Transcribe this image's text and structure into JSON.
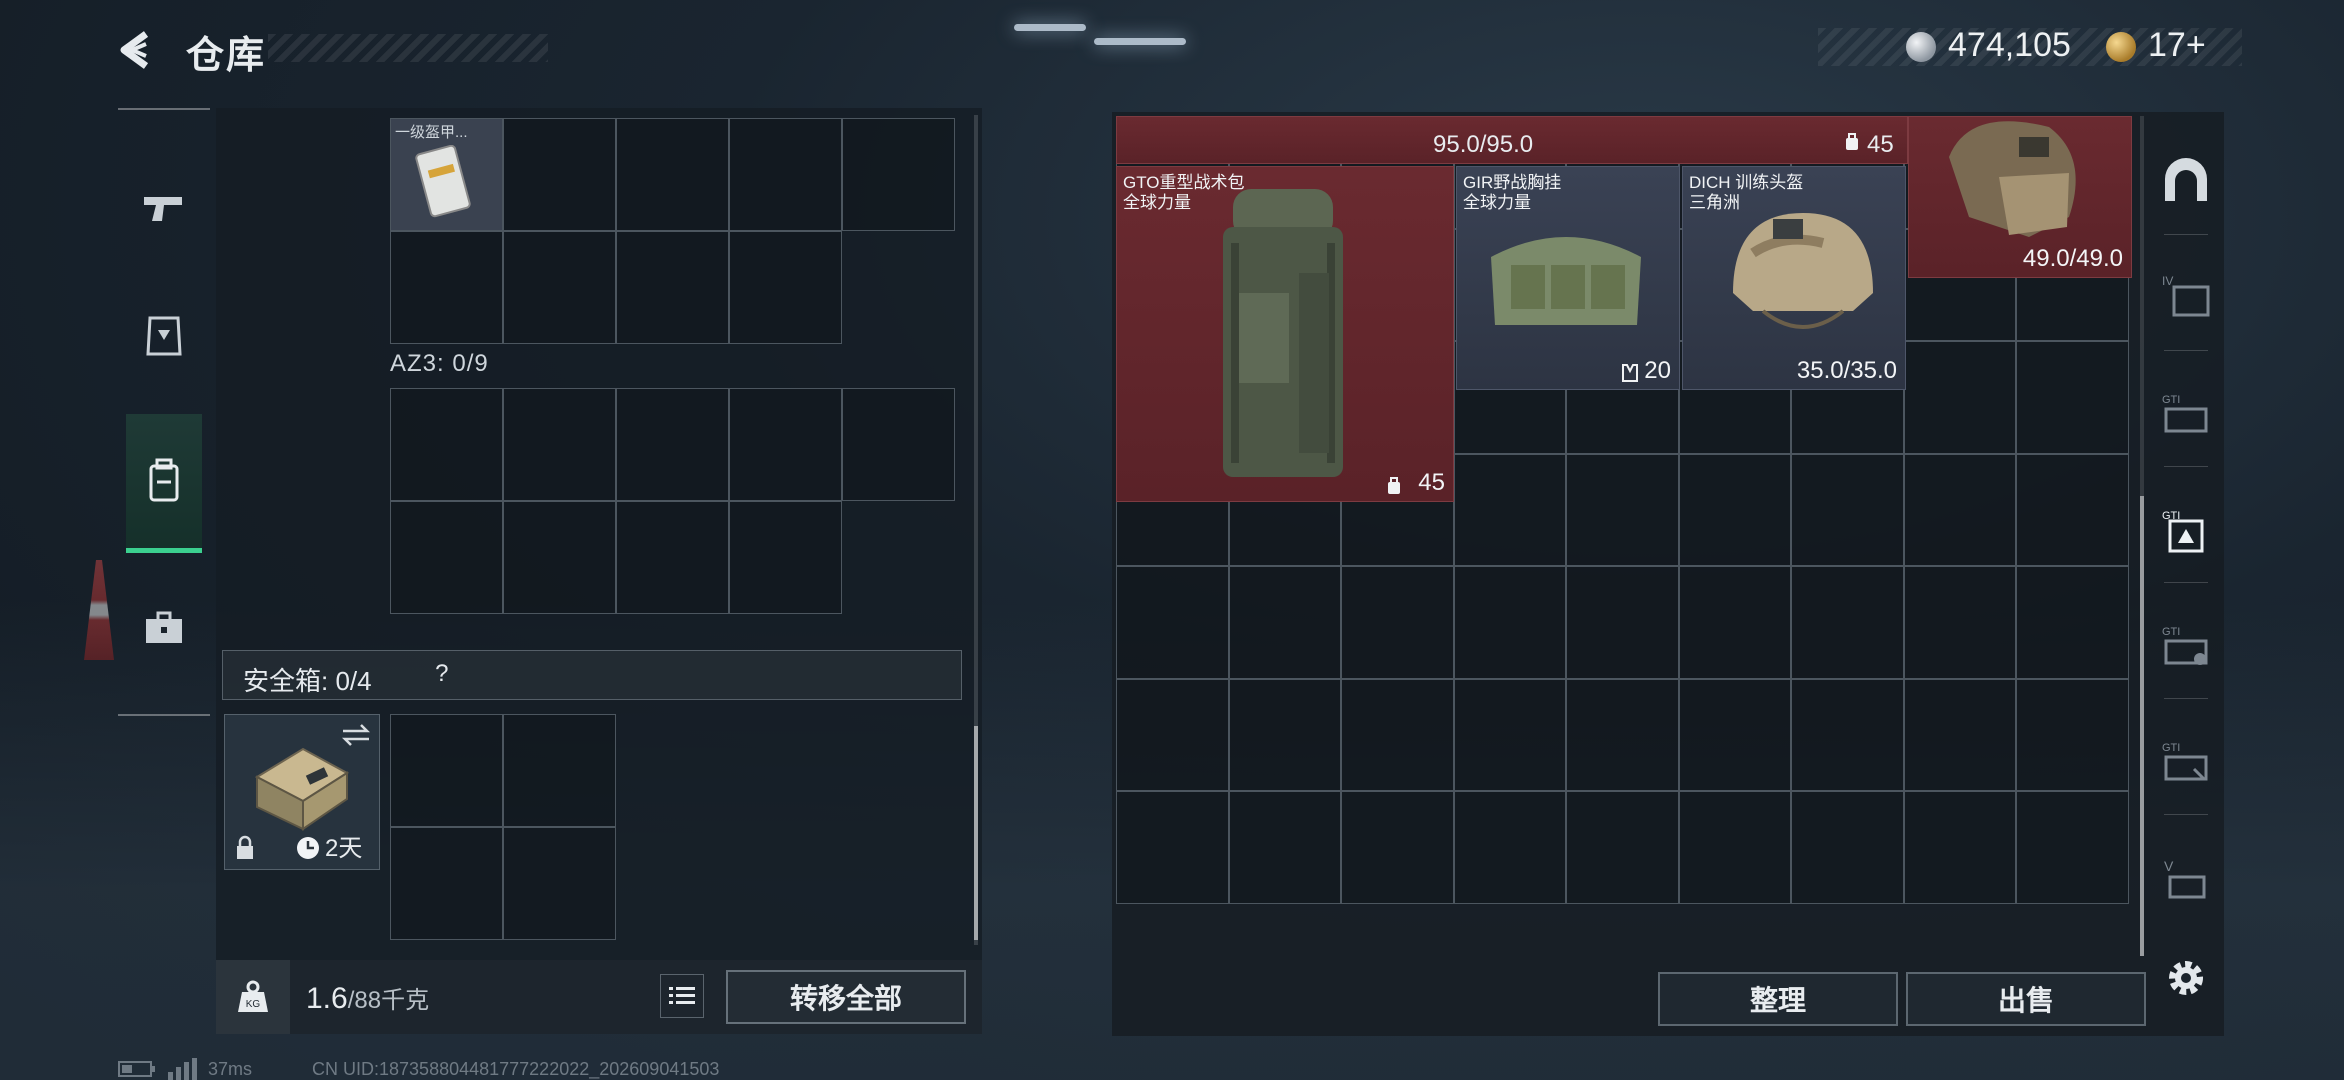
{
  "header": {
    "title": "仓库"
  },
  "currency": {
    "silver_value": "474,105",
    "gold_value": "17+"
  },
  "left": {
    "cell_item_label": "一级盔甲...",
    "az3_label": "AZ3: 0/9",
    "safebox_label": "安全箱: 0/4",
    "safebox_help": "?",
    "safebox_timer": "2天",
    "weight_current": "1.6",
    "weight_max": "/88千克",
    "transfer_all": "转移全部"
  },
  "right": {
    "top_strip_value": "95.0/95.0",
    "top_strip_badge": "45",
    "items": [
      {
        "name": "GTO重型战术包\n全球力量",
        "value": "45"
      },
      {
        "name": "GIR野战胸挂\n全球力量",
        "value": "20"
      },
      {
        "name": "DICH 训练头盔\n三角洲",
        "value": "35.0/35.0"
      },
      {
        "name": "",
        "value": "49.0/49.0"
      }
    ],
    "organize_btn": "整理",
    "sell_btn": "出售"
  },
  "footer": {
    "ping": "37ms",
    "uid": "CN UID:187358804481777222022_202609041503"
  },
  "icons": {
    "back": "back-arrow-icon",
    "settings": "gear-icon"
  }
}
